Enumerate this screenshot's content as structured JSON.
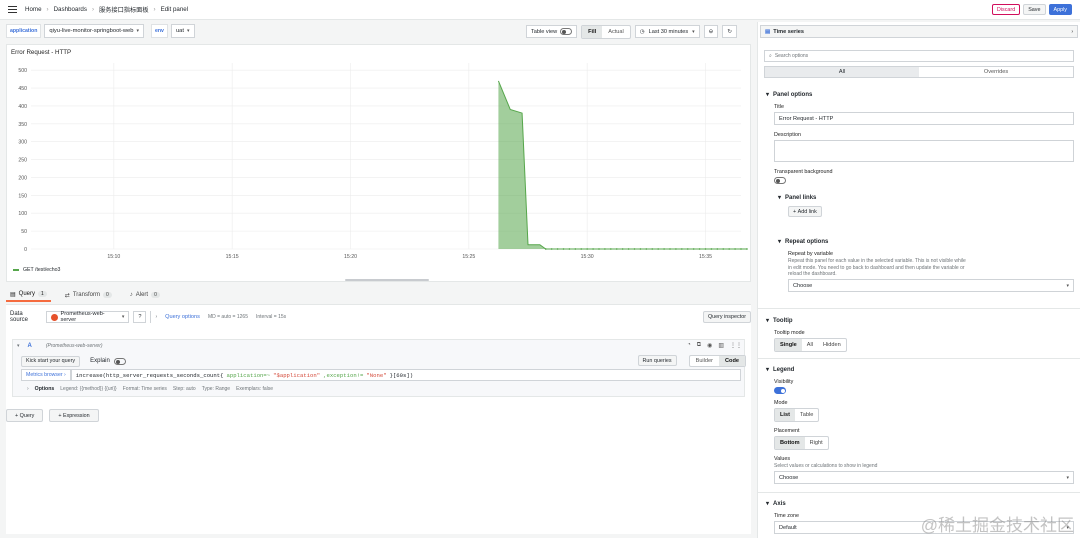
{
  "breadcrumb": {
    "home": "Home",
    "dashboards": "Dashboards",
    "dashboard": "服务接口指标面板",
    "page": "Edit panel"
  },
  "actions": {
    "discard": "Discard",
    "save": "Save",
    "apply": "Apply"
  },
  "variables": [
    {
      "label": "application",
      "value": "qiyu-live-monitor-springboot-web"
    },
    {
      "label": "env",
      "value": "uat"
    }
  ],
  "view": {
    "table_view": "Table view",
    "fill": "Fill",
    "actual": "Actual",
    "time_range": "Last 30 minutes"
  },
  "panel": {
    "title": "Error Request - HTTP",
    "legend": "GET /test/echo3"
  },
  "chart_data": {
    "type": "area",
    "title": "Error Request - HTTP",
    "x_ticks": [
      "15:10",
      "15:15",
      "15:20",
      "15:25",
      "15:30",
      "15:35"
    ],
    "y_ticks": [
      0,
      50,
      100,
      150,
      200,
      250,
      300,
      350,
      400,
      450,
      500
    ],
    "ylim": [
      0,
      520
    ],
    "series": [
      {
        "name": "GET /test/echo3",
        "color": "#56a64b",
        "points": [
          [
            "15:26:15",
            470
          ],
          [
            "15:26:45",
            390
          ],
          [
            "15:27:15",
            380
          ],
          [
            "15:27:30",
            12
          ],
          [
            "15:28:00",
            12
          ],
          [
            "15:28:15",
            0
          ],
          [
            "15:29:00",
            0
          ],
          [
            "15:30:00",
            0
          ],
          [
            "15:31:00",
            0
          ],
          [
            "15:32:00",
            0
          ],
          [
            "15:33:00",
            0
          ],
          [
            "15:34:00",
            0
          ],
          [
            "15:35:00",
            0
          ],
          [
            "15:36:00",
            0
          ],
          [
            "15:36:45",
            0
          ]
        ]
      }
    ],
    "grid": true,
    "legend_position": "bottom"
  },
  "query_tabs": [
    {
      "label": "Query",
      "count": "1"
    },
    {
      "label": "Transform",
      "count": "0"
    },
    {
      "label": "Alert",
      "count": "0"
    }
  ],
  "query": {
    "data_source_label": "Data source",
    "data_source": "Prometheus-web-server",
    "options_label": "Query options",
    "md": "MD = auto = 1265",
    "interval": "Interval = 15s",
    "inspector": "Query inspector",
    "ref": "A",
    "ref_source": "(Prometheus-web-server)",
    "kick_start": "Kick start your query",
    "explain": "Explain",
    "run": "Run queries",
    "builder": "Builder",
    "code": "Code",
    "metrics_browser": "Metrics browser ›",
    "expr_fn": "increase(http_server_requests_seconds_count{",
    "expr_k1": "application=~",
    "expr_v1": "\"$application\"",
    "expr_k2": ",exception!=",
    "expr_v2": "\"None\"",
    "expr_end": "}[60s])",
    "options": "Options",
    "opt_legend": "Legend: {{method}} {{uri}}",
    "opt_format": "Format: Time series",
    "opt_step": "Step: auto",
    "opt_type": "Type: Range",
    "opt_exemplars": "Exemplars: false",
    "add_query": "Query",
    "add_expression": "Expression"
  },
  "right": {
    "viz": "Time series",
    "search_placeholder": "Search options",
    "tab_all": "All",
    "tab_overrides": "Overrides",
    "panel_options": "Panel options",
    "title_label": "Title",
    "title_value": "Error Request - HTTP",
    "description_label": "Description",
    "transparent_label": "Transparent background",
    "panel_links": "Panel links",
    "add_link": "Add link",
    "repeat_options": "Repeat options",
    "repeat_by": "Repeat by variable",
    "repeat_desc1": "Repeat this panel for each value in the selected variable. This is not visible while",
    "repeat_desc2": "in edit mode. You need to go back to dashboard and then update the variable or",
    "repeat_desc3": "reload the dashboard.",
    "choose": "Choose",
    "tooltip": "Tooltip",
    "tooltip_mode": "Tooltip mode",
    "tm_single": "Single",
    "tm_all": "All",
    "tm_hidden": "Hidden",
    "legend": "Legend",
    "visibility": "Visibility",
    "mode": "Mode",
    "mode_list": "List",
    "mode_table": "Table",
    "placement": "Placement",
    "pl_bottom": "Bottom",
    "pl_right": "Right",
    "values": "Values",
    "values_desc": "Select values or calculations to show in legend",
    "values_choose": "Choose",
    "axis": "Axis",
    "timezone": "Time zone",
    "timezone_value": "Default"
  },
  "watermark": "@稀土掘金技术社区"
}
